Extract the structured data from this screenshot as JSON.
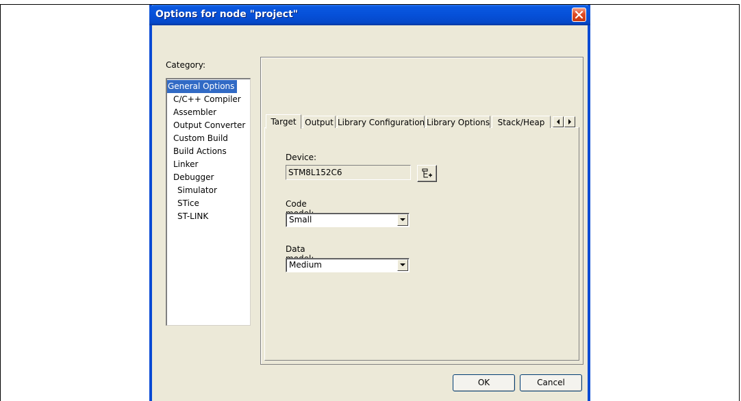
{
  "window": {
    "title": "Options for node \"project\""
  },
  "category": {
    "label": "Category:",
    "items": [
      {
        "label": "General Options",
        "level": 0,
        "selected": true
      },
      {
        "label": "C/C++ Compiler",
        "level": 1
      },
      {
        "label": "Assembler",
        "level": 1
      },
      {
        "label": "Output Converter",
        "level": 1
      },
      {
        "label": "Custom Build",
        "level": 1
      },
      {
        "label": "Build Actions",
        "level": 1
      },
      {
        "label": "Linker",
        "level": 1
      },
      {
        "label": "Debugger",
        "level": 1
      },
      {
        "label": "Simulator",
        "level": 2
      },
      {
        "label": "STice",
        "level": 2
      },
      {
        "label": "ST-LINK",
        "level": 2
      }
    ]
  },
  "tabs": [
    {
      "label": "Target",
      "active": true
    },
    {
      "label": "Output"
    },
    {
      "label": "Library Configuration"
    },
    {
      "label": "Library Options"
    },
    {
      "label": "Stack/Heap"
    }
  ],
  "target": {
    "device_label": "Device:",
    "device_value": "STM8L152C6",
    "code_model_label": "Code model:",
    "code_model_value": "Small",
    "data_model_label": "Data model:",
    "data_model_value": "Medium"
  },
  "buttons": {
    "ok": "OK",
    "cancel": "Cancel"
  },
  "icons": {
    "close": "close-icon",
    "device_select": "device-select-icon",
    "tab_left": "arrow-left-icon",
    "tab_right": "arrow-right-icon",
    "dropdown": "chevron-down-icon"
  },
  "colors": {
    "titlebar": "#0650d8",
    "selection": "#316ac5",
    "dialog_bg": "#ece9d8"
  }
}
